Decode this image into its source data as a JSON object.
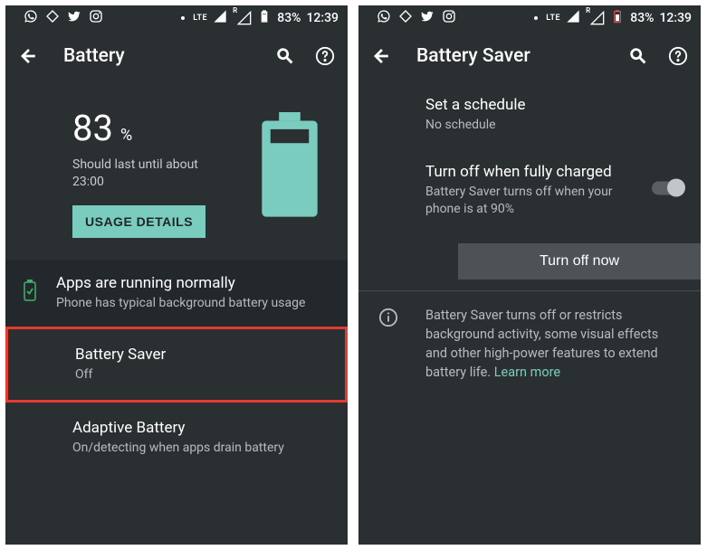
{
  "status": {
    "lte": "LTE",
    "r": "R",
    "battery_pct": "83%",
    "time": "12:39"
  },
  "screen1": {
    "title": "Battery",
    "pct_number": "83",
    "pct_sign": "%",
    "estimate": "Should last until about 23:00",
    "usage_button": "USAGE DETAILS",
    "apps_title": "Apps are running normally",
    "apps_sub": "Phone has typical background battery usage",
    "saver_title": "Battery Saver",
    "saver_sub": "Off",
    "adaptive_title": "Adaptive Battery",
    "adaptive_sub": "On/detecting when apps drain battery"
  },
  "screen2": {
    "title": "Battery Saver",
    "schedule_title": "Set a schedule",
    "schedule_sub": "No schedule",
    "full_title": "Turn off when fully charged",
    "full_sub": "Battery Saver turns off when your phone is at 90%",
    "turn_off_btn": "Turn off now",
    "info_text": "Battery Saver turns off or restricts background activity, some visual effects and other high-power features to extend battery life. ",
    "learn_more": "Learn more"
  }
}
